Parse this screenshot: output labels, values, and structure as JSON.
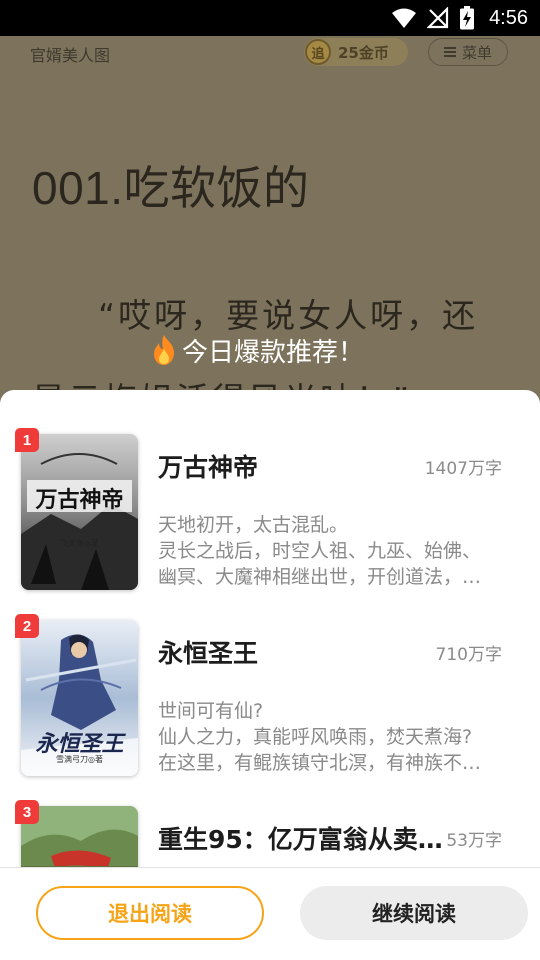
{
  "status_bar": {
    "time": "4:56"
  },
  "reader": {
    "book_name": "官婿美人图",
    "coins": {
      "label": "25金币",
      "icon_char": "追"
    },
    "menu_label": "菜单",
    "chapter_title": "001.吃软饭的",
    "chapter_text": "“哎呀，要说女人呀，还是云梅姐活得风光呐！”"
  },
  "promo": {
    "title": "今日爆款推荐！"
  },
  "books": [
    {
      "rank": "1",
      "title": "万古神帝",
      "word_count": "1407万字",
      "desc_lines": [
        "天地初开，太古混乱。",
        "灵长之战后，时空人祖、九巫、始佛、",
        "幽冥、大魔神相继出世，开创道法，…"
      ],
      "cover_title": "万古神帝",
      "cover_author": "飞天鱼◎著"
    },
    {
      "rank": "2",
      "title": "永恒圣王",
      "word_count": "710万字",
      "desc_lines": [
        "世间可有仙?",
        "仙人之力，真能呼风唤雨，焚天煮海?",
        "在这里，有鲲族镇守北溟，有神族不…"
      ],
      "cover_title": "永恒圣王",
      "cover_author": "雪满弓刀◎著"
    },
    {
      "rank": "3",
      "title": "重生95：亿万富翁从卖…",
      "word_count": "53万字",
      "desc_lines": [],
      "cover_title": "",
      "cover_author": ""
    }
  ],
  "footer": {
    "exit_label": "退出阅读",
    "continue_label": "继续阅读"
  },
  "colors": {
    "accent": "#f5a418",
    "rank_badge": "#f03b3b",
    "overlay_bg": "#7d735d"
  }
}
